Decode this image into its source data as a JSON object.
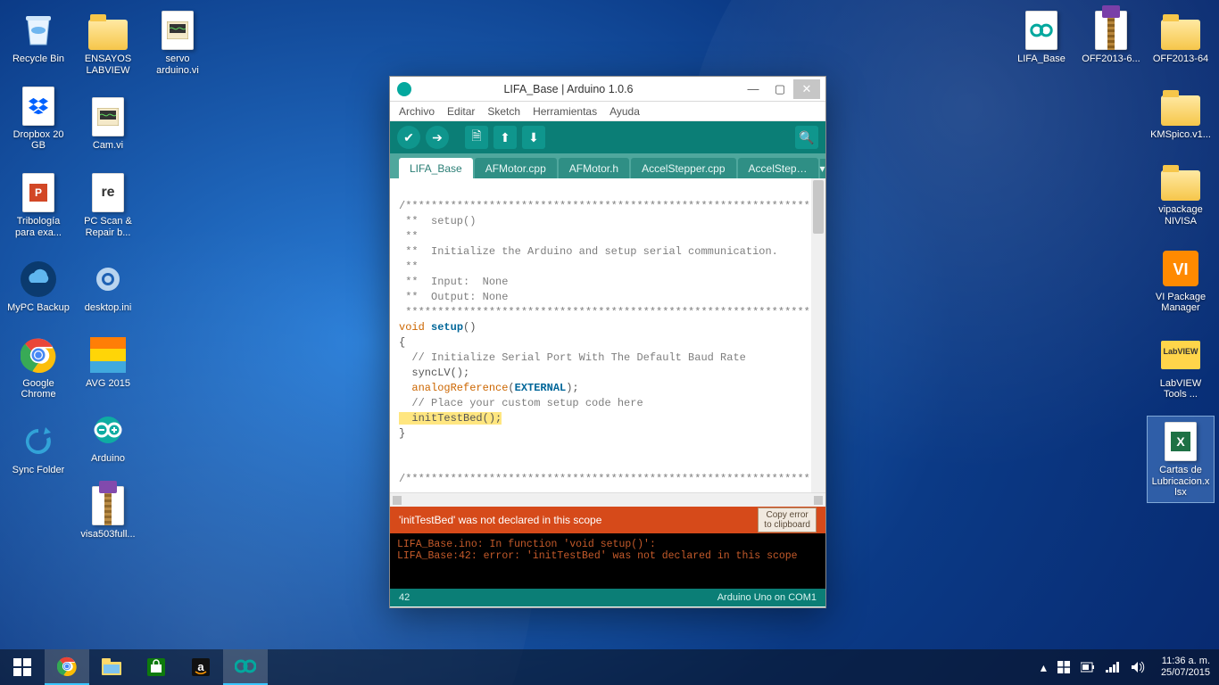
{
  "desktop_icons_left": [
    [
      {
        "label": "Recycle Bin",
        "name": "recycle-bin",
        "glyph": "bin"
      },
      {
        "label": "Dropbox 20 GB",
        "name": "dropbox",
        "glyph": "dropbox"
      },
      {
        "label": "Tribología para exa...",
        "name": "tribologia",
        "glyph": "ppt"
      },
      {
        "label": "MyPC Backup",
        "name": "mypc-backup",
        "glyph": "cloud"
      },
      {
        "label": "Google Chrome",
        "name": "chrome",
        "glyph": "chrome"
      },
      {
        "label": "Sync Folder",
        "name": "sync-folder",
        "glyph": "sync"
      }
    ],
    [
      {
        "label": "ENSAYOS LABVIEW",
        "name": "ensayos-labview",
        "glyph": "folder"
      },
      {
        "label": "Cam.vi",
        "name": "cam-vi",
        "glyph": "vi"
      },
      {
        "label": "PC Scan & Repair b...",
        "name": "pc-scan",
        "glyph": "reimage"
      },
      {
        "label": "desktop.ini",
        "name": "desktop-ini",
        "glyph": "gear"
      },
      {
        "label": "AVG 2015",
        "name": "avg",
        "glyph": "avg"
      },
      {
        "label": "Arduino",
        "name": "arduino-shortcut",
        "glyph": "arduino"
      },
      {
        "label": "visa503full...",
        "name": "visa503",
        "glyph": "zip"
      }
    ],
    [
      {
        "label": "servo arduino.vi",
        "name": "servo-vi",
        "glyph": "vi"
      }
    ]
  ],
  "desktop_icons_right": [
    [
      {
        "label": "OFF2013-64",
        "name": "off2013-64",
        "glyph": "folder"
      },
      {
        "label": "KMSpico.v1...",
        "name": "kmspico",
        "glyph": "folder"
      },
      {
        "label": "vipackage NIVISA",
        "name": "vipackage",
        "glyph": "folder"
      },
      {
        "label": "VI Package Manager",
        "name": "vipm",
        "glyph": "vipm"
      },
      {
        "label": "LabVIEW Tools ...",
        "name": "labview-tools",
        "glyph": "labview"
      },
      {
        "label": "Cartas de Lubricacion.x lsx",
        "name": "cartas-xlsx",
        "glyph": "xlsx",
        "selected": true
      }
    ],
    [
      {
        "label": "OFF2013-6...",
        "name": "off2013-6",
        "glyph": "zip"
      }
    ],
    [
      {
        "label": "LIFA_Base",
        "name": "lifa-base-folder",
        "glyph": "arduino-file"
      }
    ]
  ],
  "window": {
    "title": "LIFA_Base | Arduino 1.0.6",
    "menu": [
      "Archivo",
      "Editar",
      "Sketch",
      "Herramientas",
      "Ayuda"
    ],
    "tabs": [
      "LIFA_Base",
      "AFMotor.cpp",
      "AFMotor.h",
      "AccelStepper.cpp",
      "AccelStep…"
    ],
    "error_msg": "'initTestBed' was not declared in this scope",
    "copy_btn_line1": "Copy error",
    "copy_btn_line2": "to clipboard",
    "console_line1": "LIFA_Base.ino: In function 'void setup()':",
    "console_line2": "LIFA_Base:42: error: 'initTestBed' was not declared in this scope",
    "status_line": "42",
    "status_board": "Arduino Uno on COM1",
    "code": {
      "stars1": "/*********************************************************************************",
      "l1": " **  setup()",
      "l2": " **",
      "l3": " **  Initialize the Arduino and setup serial communication.",
      "l4": " **",
      "l5": " **  Input:  None",
      "l6": " **  Output: None",
      "stars2": " *********************************************************************************/",
      "void": "void",
      "setup": "setup",
      "paren": "()",
      "brace_open": "{",
      "c1": "  // Initialize Serial Port With The Default Baud Rate",
      "sync": "  syncLV();",
      "analog": "  analogReference",
      "ext": "EXTERNAL",
      "analog_close": ");",
      "analog_open": "(",
      "c2": "  // Place your custom setup code here",
      "hl": "  initTestBed();",
      "brace_close": "}",
      "blank": "",
      "stars3": "/********************************************************************************"
    }
  },
  "taskbar": {
    "time": "11:36 a. m.",
    "date": "25/07/2015"
  }
}
